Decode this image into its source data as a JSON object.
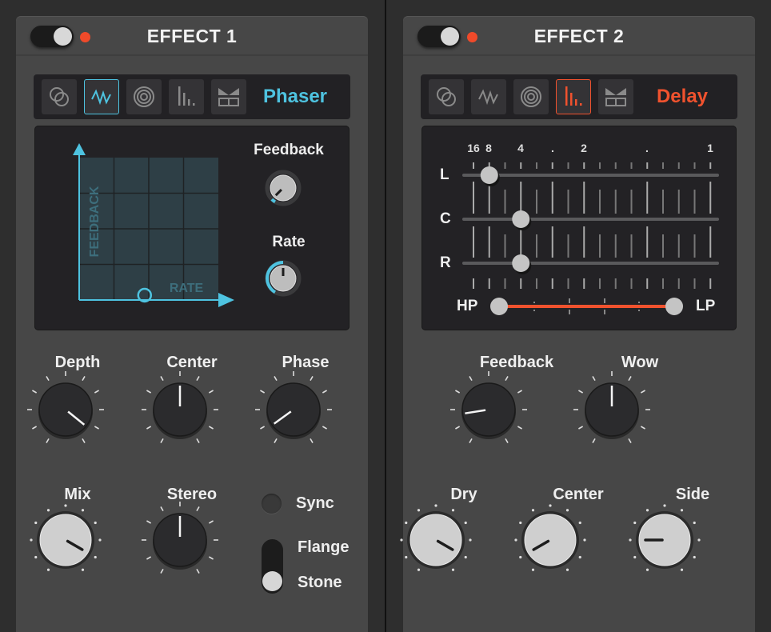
{
  "effect1": {
    "title": "EFFECT 1",
    "power_on": true,
    "accent": "#4ec3e0",
    "selector": {
      "icons": [
        "chorus-icon",
        "phaser-icon",
        "reverb-icon",
        "delay-icon",
        "filter-icon"
      ],
      "active": 1,
      "label": "Phaser"
    },
    "xy_pad": {
      "x_label": "RATE",
      "y_label": "FEEDBACK",
      "point_x": 0.47,
      "point_y": 0.0
    },
    "display_knobs": [
      {
        "label": "Feedback",
        "value": 0.05
      },
      {
        "label": "Rate",
        "value": 0.5
      }
    ],
    "knobs": [
      {
        "label": "Depth",
        "value": 0.93
      },
      {
        "label": "Center",
        "value": 0.5
      },
      {
        "label": "Phase",
        "value": 0.08
      },
      {
        "label": "Mix",
        "value": 0.9
      },
      {
        "label": "Stereo",
        "value": 0.5
      }
    ],
    "sync": {
      "label": "Sync",
      "on": false
    },
    "mode_switch": {
      "options": [
        "Flange",
        "Stone"
      ],
      "selected": "Stone"
    }
  },
  "effect2": {
    "title": "EFFECT 2",
    "power_on": true,
    "accent": "#f0522e",
    "selector": {
      "icons": [
        "chorus-icon",
        "phaser-icon",
        "reverb-icon",
        "delay-icon",
        "filter-icon"
      ],
      "active": 3,
      "label": "Delay"
    },
    "delay": {
      "tick_labels": [
        "16",
        "8",
        "4",
        ".",
        "2",
        ".",
        "1"
      ],
      "rows": [
        {
          "label": "L",
          "value": "8"
        },
        {
          "label": "C",
          "value": "4"
        },
        {
          "label": "R",
          "value": "4"
        }
      ],
      "filter": {
        "hp_label": "HP",
        "lp_label": "LP",
        "hp": 0.0,
        "lp": 1.0
      }
    },
    "knobs": [
      {
        "label": "Feedback",
        "value": 0.17
      },
      {
        "label": "Wow",
        "value": 0.5
      },
      {
        "label": "Dry",
        "value": 0.9
      },
      {
        "label": "Center",
        "value": 0.1
      },
      {
        "label": "Side",
        "value": 0.2
      }
    ]
  }
}
